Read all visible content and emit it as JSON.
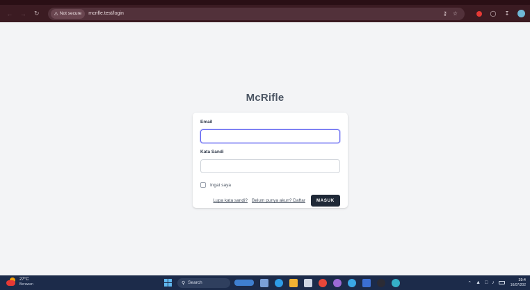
{
  "browser": {
    "security_label": "Not secure",
    "url": "mcrifle.test/login",
    "icons": [
      "back-icon",
      "forward-icon",
      "reload-icon",
      "key-icon",
      "star-icon",
      "extension-icon",
      "puzzle-icon",
      "download-icon",
      "profile-icon"
    ]
  },
  "app": {
    "title": "McRifle"
  },
  "login_form": {
    "email_label": "Email",
    "email_value": "",
    "password_label": "Kata Sandi",
    "password_value": "",
    "remember_label": "Ingat saya",
    "remember_checked": false,
    "forgot_link": "Lupa kata sandi?",
    "register_link": "Belum punya akun? Daftar",
    "submit_label": "MASUK"
  },
  "taskbar": {
    "weather_temp": "27°C",
    "weather_condition": "Berawan",
    "search_label": "Search",
    "clock_time": "19:4",
    "clock_date": "16/07/202"
  },
  "colors": {
    "browser_chrome": "#3b1b22",
    "page_background": "#f3f4f6",
    "focus_ring": "#6366f1",
    "primary_button": "#1f2937",
    "taskbar": "#1c2b4a"
  }
}
